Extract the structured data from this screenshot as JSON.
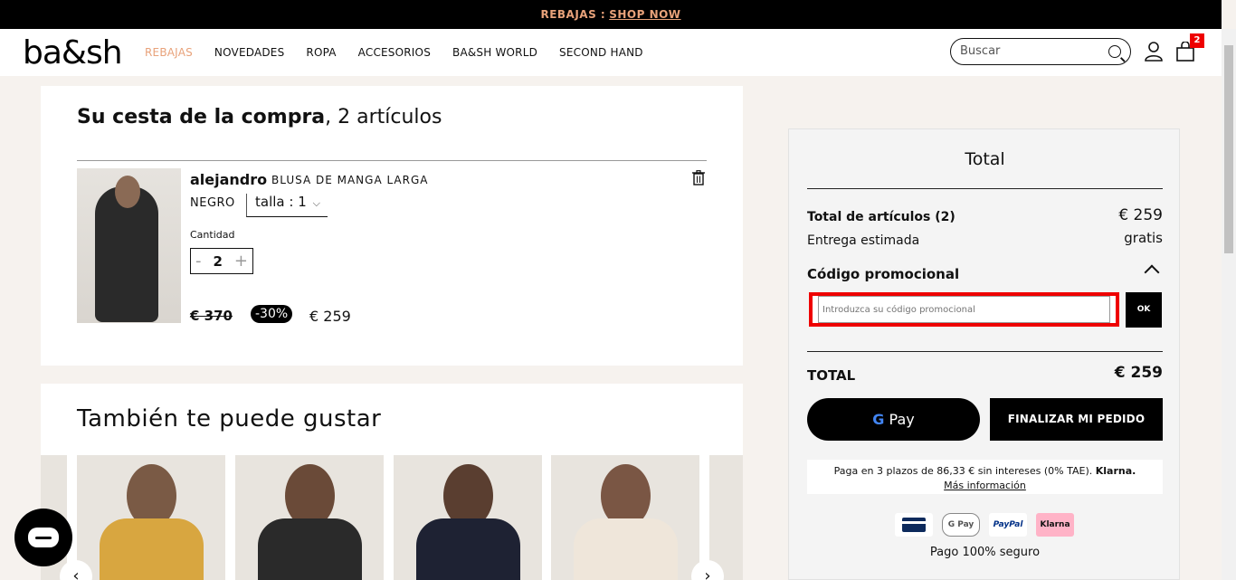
{
  "promo_bar": {
    "label": "REBAJAS :",
    "link": "SHOP NOW"
  },
  "header": {
    "logo": "ba&sh",
    "nav": [
      "REBAJAS",
      "NOVEDADES",
      "ROPA",
      "ACCESORIOS",
      "BA&SH WORLD",
      "SECOND HAND"
    ],
    "search_placeholder": "Buscar",
    "bag_count": "2"
  },
  "cart": {
    "title_bold": "Su cesta de la compra",
    "title_rest": ", 2 artículos",
    "item": {
      "name": "alejandro",
      "type": "BLUSA DE MANGA LARGA",
      "color": "NEGRO",
      "size_label": "talla : 1",
      "qty_label": "Cantidad",
      "qty_minus": "-",
      "qty_value": "2",
      "qty_plus": "+",
      "price_old": "€ 370",
      "discount": "-30%",
      "price_new": "€ 259"
    }
  },
  "recommendations": {
    "title": "También te puede gustar",
    "prev": "‹",
    "next": "›"
  },
  "summary": {
    "title": "Total",
    "items_label": "Total de artículos (2)",
    "items_value": "€ 259",
    "delivery_label": "Entrega estimada",
    "delivery_value": "gratis",
    "promo_label": "Código promocional",
    "promo_placeholder": "Introduzca su código promocional",
    "ok": "OK",
    "total_label": "TOTAL",
    "total_value": "€ 259",
    "gpay_label": "Pay",
    "gpay_g": "G",
    "checkout": "FINALIZAR MI PEDIDO",
    "klarna_text": "Paga en 3 plazos de 86,33 € sin intereses (0% TAE).",
    "klarna_brand": "Klarna.",
    "klarna_more": "Más información",
    "pay_methods": [
      "card",
      "G Pay",
      "PayPal",
      "Klarna"
    ],
    "secure": "Pago 100% seguro"
  },
  "colors": {
    "accent": "#e8a27a",
    "highlight": "#ee0000"
  }
}
